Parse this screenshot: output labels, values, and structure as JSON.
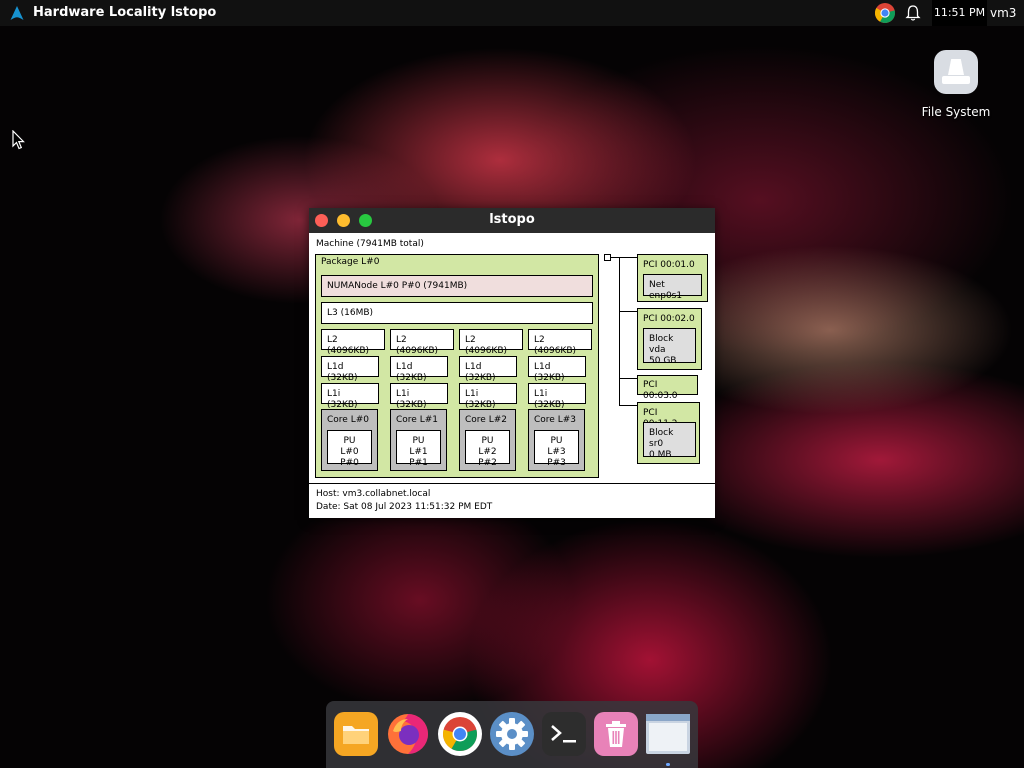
{
  "topbar": {
    "app_title": "Hardware Locality lstopo",
    "clock": "11:51 PM",
    "user": "vm3"
  },
  "desktop": {
    "file_system_label": "File System"
  },
  "window": {
    "title": "lstopo",
    "machine_label": "Machine (7941MB total)",
    "package_label": "Package L#0",
    "numa_label": "NUMANode L#0 P#0 (7941MB)",
    "l3_label": "L3 (16MB)",
    "cores": [
      {
        "l2": "L2 (4096KB)",
        "l1d": "L1d (32KB)",
        "l1i": "L1i (32KB)",
        "core": "Core L#0",
        "pu1": "PU L#0",
        "pu2": "P#0"
      },
      {
        "l2": "L2 (4096KB)",
        "l1d": "L1d (32KB)",
        "l1i": "L1i (32KB)",
        "core": "Core L#1",
        "pu1": "PU L#1",
        "pu2": "P#1"
      },
      {
        "l2": "L2 (4096KB)",
        "l1d": "L1d (32KB)",
        "l1i": "L1i (32KB)",
        "core": "Core L#2",
        "pu1": "PU L#2",
        "pu2": "P#2"
      },
      {
        "l2": "L2 (4096KB)",
        "l1d": "L1d (32KB)",
        "l1i": "L1i (32KB)",
        "core": "Core L#3",
        "pu1": "PU L#3",
        "pu2": "P#3"
      }
    ],
    "pci": [
      {
        "label": "PCI 00:01.0",
        "dev1": "Net enp0s1",
        "dev2": ""
      },
      {
        "label": "PCI 00:02.0",
        "dev1": "Block vda",
        "dev2": "50 GB"
      },
      {
        "label": "PCI 00:03.0",
        "dev1": "",
        "dev2": ""
      },
      {
        "label": "PCI 00:11.2",
        "dev1": "Block sr0",
        "dev2": "0 MB"
      }
    ],
    "host": "Host: vm3.collabnet.local",
    "date": "Date: Sat 08 Jul 2023 11:51:32 PM EDT"
  },
  "dock": {
    "items": [
      "files-icon",
      "firefox-icon",
      "chrome-icon",
      "settings-icon",
      "terminal-icon",
      "trash-icon",
      "window-icon"
    ]
  },
  "colors": {
    "package_green": "#d2e7a4",
    "numa_pink": "#f0dedd",
    "core_gray": "#bebebe",
    "device_gray": "#dedede"
  }
}
